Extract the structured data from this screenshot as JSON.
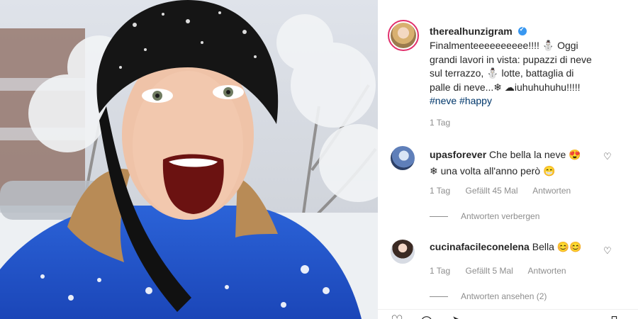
{
  "post": {
    "username": "therealhunzigram",
    "caption_lines": [
      "Finalmenteeeeeeeeee!!!! ⛄ Oggi",
      "grandi lavori in vista: pupazzi di neve",
      "sul terrazzo, ⛄ lotte, battaglia di",
      "palle di neve...❄ ☁iuhuhuhuhu!!!!!"
    ],
    "hashtags": "#neve #happy",
    "time": "1 Tag"
  },
  "comments": [
    {
      "username": "upasforever",
      "text_line1": "Che bella la neve 😍",
      "text_line2": "❄ una volta all'anno però 😁",
      "time": "1 Tag",
      "likes": "Gefällt 45 Mal",
      "reply": "Antworten",
      "replies_toggle": "Antworten verbergen"
    },
    {
      "username": "cucinafacileconelena",
      "text_line1": "Bella 😊😊",
      "time": "1 Tag",
      "likes": "Gefällt 5 Mal",
      "reply": "Antworten",
      "replies_toggle": "Antworten ansehen (2)"
    }
  ],
  "icons": {
    "like": "heart-icon",
    "comment": "comment-icon",
    "share": "share-icon",
    "save": "bookmark-icon"
  },
  "colors": {
    "text": "#262626",
    "muted": "#8e8e8e",
    "hashtag": "#00376b",
    "verified": "#3897f0"
  }
}
